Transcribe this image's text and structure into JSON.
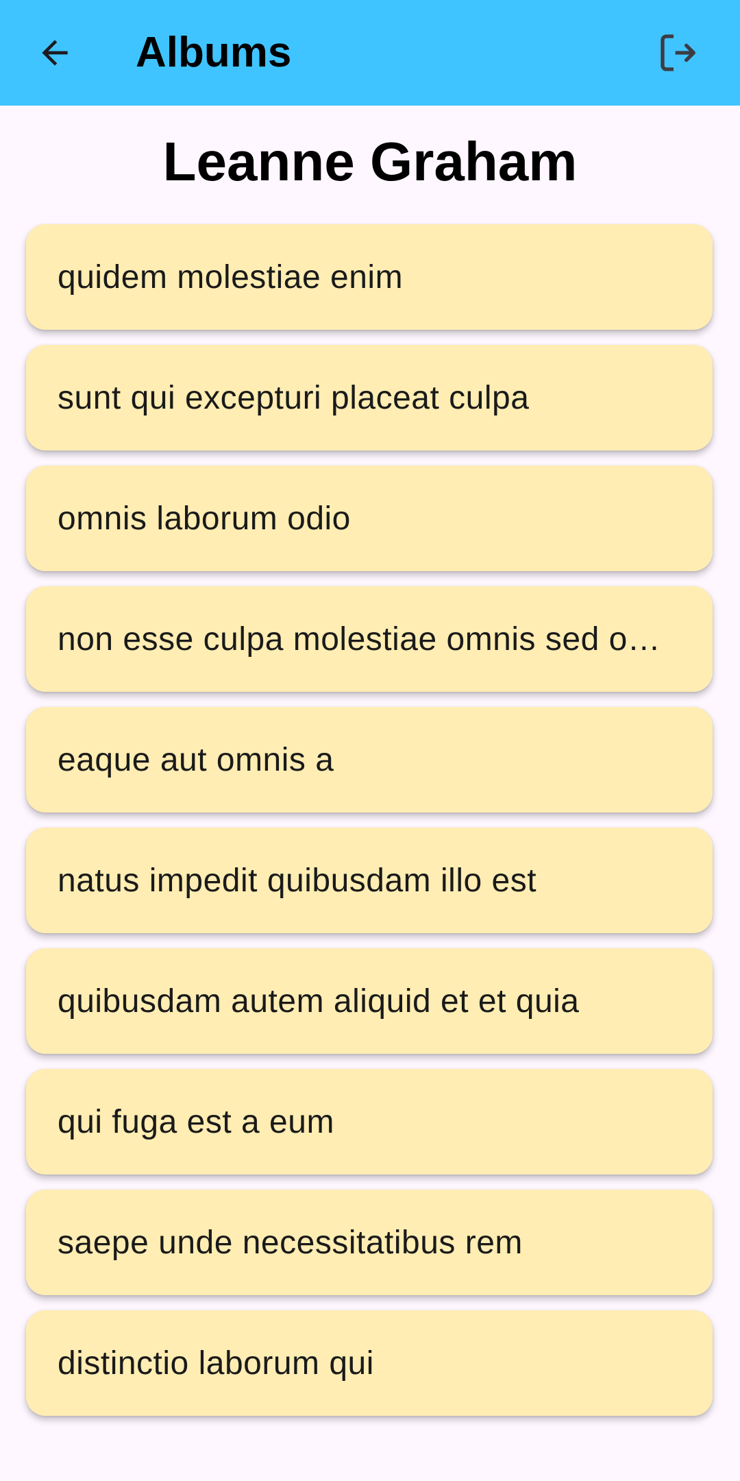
{
  "app_bar": {
    "title": "Albums",
    "back_icon": "arrow-left-icon",
    "logout_icon": "logout-icon",
    "background_color": "#40C4FF"
  },
  "user": {
    "name": "Leanne Graham"
  },
  "albums": [
    {
      "title": "quidem molestiae enim"
    },
    {
      "title": "sunt qui excepturi placeat culpa"
    },
    {
      "title": "omnis laborum odio"
    },
    {
      "title": "non esse culpa molestiae omnis sed optio"
    },
    {
      "title": "eaque aut omnis a"
    },
    {
      "title": "natus impedit quibusdam illo est"
    },
    {
      "title": "quibusdam autem aliquid et et quia"
    },
    {
      "title": "qui fuga est a eum"
    },
    {
      "title": "saepe unde necessitatibus rem"
    },
    {
      "title": "distinctio laborum qui"
    }
  ],
  "colors": {
    "card_background": "#FFEDB3",
    "page_background": "#FEF7FF"
  }
}
